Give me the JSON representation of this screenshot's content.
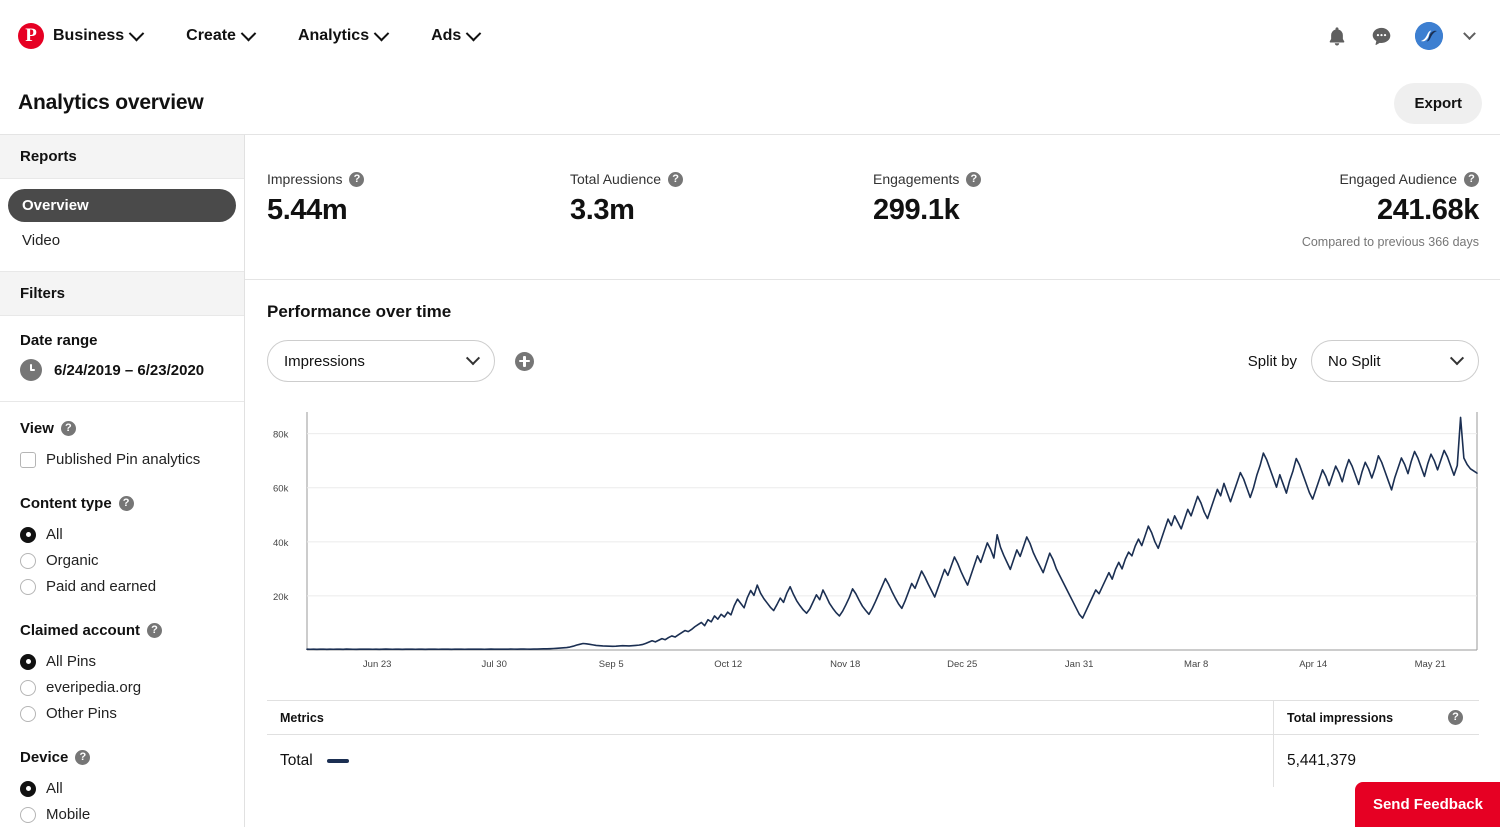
{
  "nav": {
    "logo_icon": "pinterest-logo-icon",
    "items": [
      {
        "label": "Business",
        "icon": "chevron-down-icon"
      },
      {
        "label": "Create",
        "icon": "chevron-down-icon"
      },
      {
        "label": "Analytics",
        "icon": "chevron-down-icon"
      },
      {
        "label": "Ads",
        "icon": "chevron-down-icon"
      }
    ],
    "right_icons": [
      "bell-icon",
      "chat-bubble-icon",
      "avatar",
      "chevron-down-icon"
    ]
  },
  "header": {
    "title": "Analytics overview",
    "export_label": "Export"
  },
  "sidebar": {
    "reports_heading": "Reports",
    "links": [
      {
        "label": "Overview",
        "active": true
      },
      {
        "label": "Video",
        "active": false
      }
    ],
    "filters_heading": "Filters",
    "date_range": {
      "title": "Date range",
      "value": "6/24/2019 – 6/23/2020",
      "icon": "clock-icon"
    },
    "view": {
      "title": "View",
      "help_icon": "help-icon",
      "options": [
        {
          "label": "Published Pin analytics",
          "checked": false
        }
      ]
    },
    "content_type": {
      "title": "Content type",
      "help_icon": "help-icon",
      "options": [
        {
          "label": "All",
          "selected": true
        },
        {
          "label": "Organic",
          "selected": false
        },
        {
          "label": "Paid and earned",
          "selected": false
        }
      ]
    },
    "claimed_account": {
      "title": "Claimed account",
      "help_icon": "help-icon",
      "options": [
        {
          "label": "All Pins",
          "selected": true
        },
        {
          "label": "everipedia.org",
          "selected": false
        },
        {
          "label": "Other Pins",
          "selected": false
        }
      ]
    },
    "device": {
      "title": "Device",
      "help_icon": "help-icon",
      "options": [
        {
          "label": "All",
          "selected": true
        },
        {
          "label": "Mobile",
          "selected": false
        }
      ]
    }
  },
  "metrics": [
    {
      "label": "Impressions",
      "value": "5.44m",
      "sub": ""
    },
    {
      "label": "Total Audience",
      "value": "3.3m",
      "sub": ""
    },
    {
      "label": "Engagements",
      "value": "299.1k",
      "sub": ""
    },
    {
      "label": "Engaged Audience",
      "value": "241.68k",
      "sub": "Compared to previous 366 days"
    }
  ],
  "chart_section": {
    "heading": "Performance over time",
    "metric_select": "Impressions",
    "add_metric_icon": "plus-circle-icon",
    "split_by_label": "Split by",
    "split_by_select": "No Split"
  },
  "table": {
    "col_metrics": "Metrics",
    "col_total": "Total impressions",
    "help_icon": "help-icon",
    "rows": [
      {
        "name": "Total",
        "total": "5,441,379",
        "color": "#1b2f52"
      }
    ]
  },
  "feedback": {
    "label": "Send Feedback",
    "color": "#e60023"
  },
  "colors": {
    "brand_red": "#e60023",
    "line_navy": "#1b2f52",
    "sidebar_active": "#4a4a4a",
    "grid": "#ebebeb"
  },
  "chart_data": {
    "type": "line",
    "title": "Performance over time",
    "xlabel": "",
    "ylabel": "Impressions",
    "ylim": [
      0,
      88000
    ],
    "yticks": [
      20000,
      40000,
      60000,
      80000
    ],
    "ytick_labels": [
      "20k",
      "40k",
      "60k",
      "80k"
    ],
    "grid": true,
    "legend": "No Split",
    "xtick_labels": [
      "Jun 23",
      "Jul 30",
      "Sep 5",
      "Oct 12",
      "Nov 18",
      "Dec 25",
      "Jan 31",
      "Mar 8",
      "Apr 14",
      "May 21"
    ],
    "series": [
      {
        "name": "Total",
        "color": "#1b2f52",
        "total": 5441379,
        "values": [
          300,
          280,
          310,
          260,
          290,
          320,
          270,
          300,
          280,
          310,
          290,
          270,
          330,
          300,
          280,
          260,
          300,
          320,
          290,
          310,
          280,
          300,
          270,
          290,
          330,
          300,
          280,
          310,
          290,
          270,
          300,
          320,
          290,
          280,
          310,
          300,
          270,
          290,
          320,
          300,
          280,
          310,
          290,
          300,
          270,
          320,
          300,
          290,
          280,
          310,
          300,
          290,
          320,
          300,
          280,
          310,
          330,
          300,
          290,
          320,
          310,
          300,
          340,
          320,
          300,
          330,
          350,
          320,
          310,
          340,
          360,
          380,
          420,
          450,
          500,
          560,
          620,
          700,
          800,
          900,
          1100,
          1400,
          1800,
          2100,
          2400,
          2300,
          2100,
          1900,
          1700,
          1600,
          1500,
          1450,
          1400,
          1350,
          1400,
          1500,
          1600,
          1550,
          1500,
          1600,
          1700,
          1800,
          2000,
          2400,
          2900,
          3400,
          3000,
          3600,
          4200,
          3800,
          4600,
          5200,
          4800,
          5600,
          6400,
          7200,
          6800,
          7600,
          8600,
          9400,
          10200,
          9000,
          11200,
          10400,
          12600,
          11400,
          13200,
          12200,
          14000,
          13000,
          16400,
          18800,
          17200,
          15600,
          19400,
          22000,
          20200,
          24000,
          21000,
          19000,
          17400,
          15800,
          14600,
          16800,
          19200,
          17600,
          21000,
          23400,
          20600,
          18200,
          16400,
          14800,
          13600,
          15200,
          17800,
          20400,
          18600,
          22200,
          19800,
          17200,
          15400,
          13800,
          12600,
          14400,
          16800,
          19400,
          22600,
          20800,
          18400,
          16200,
          14600,
          13200,
          15400,
          18000,
          20800,
          23600,
          26400,
          24200,
          21600,
          19200,
          17000,
          15400,
          18200,
          21400,
          24600,
          22800,
          26000,
          29200,
          27000,
          24400,
          22000,
          19600,
          23000,
          26400,
          29800,
          27600,
          31000,
          34400,
          32000,
          29000,
          26400,
          24000,
          27600,
          31200,
          34800,
          32400,
          36000,
          39600,
          37200,
          34000,
          42600,
          38000,
          35000,
          32400,
          29800,
          33400,
          37000,
          34600,
          38200,
          41800,
          39400,
          36000,
          33400,
          31000,
          28600,
          32200,
          35800,
          33400,
          30000,
          27600,
          25200,
          22800,
          20400,
          18000,
          15600,
          13200,
          11800,
          14400,
          17000,
          19600,
          22200,
          20800,
          23400,
          26000,
          28600,
          26200,
          29800,
          32400,
          30000,
          33600,
          36200,
          34800,
          38400,
          41000,
          38600,
          42200,
          45800,
          43400,
          40000,
          37600,
          41200,
          44800,
          48400,
          46000,
          49600,
          47200,
          44800,
          48400,
          52000,
          49600,
          53200,
          56800,
          54400,
          51000,
          48600,
          52200,
          55800,
          59400,
          57000,
          61600,
          58200,
          54800,
          58400,
          62000,
          65600,
          63200,
          59800,
          56400,
          60000,
          64600,
          68200,
          72800,
          70400,
          67000,
          63600,
          60200,
          64800,
          61400,
          58000,
          62600,
          66200,
          70800,
          68400,
          65000,
          61600,
          58200,
          55800,
          59400,
          63000,
          66600,
          64200,
          60800,
          64400,
          68000,
          65600,
          62200,
          66800,
          70400,
          68000,
          64600,
          61200,
          65800,
          69400,
          67000,
          63600,
          67200,
          71800,
          69400,
          66000,
          62600,
          59200,
          63800,
          67400,
          71000,
          68600,
          65200,
          69800,
          73400,
          71000,
          67600,
          64200,
          68800,
          72400,
          70000,
          66600,
          70200,
          73800,
          71400,
          68000,
          64600,
          68200,
          86000,
          71000,
          68600,
          67000,
          66200,
          65400
        ]
      }
    ]
  }
}
